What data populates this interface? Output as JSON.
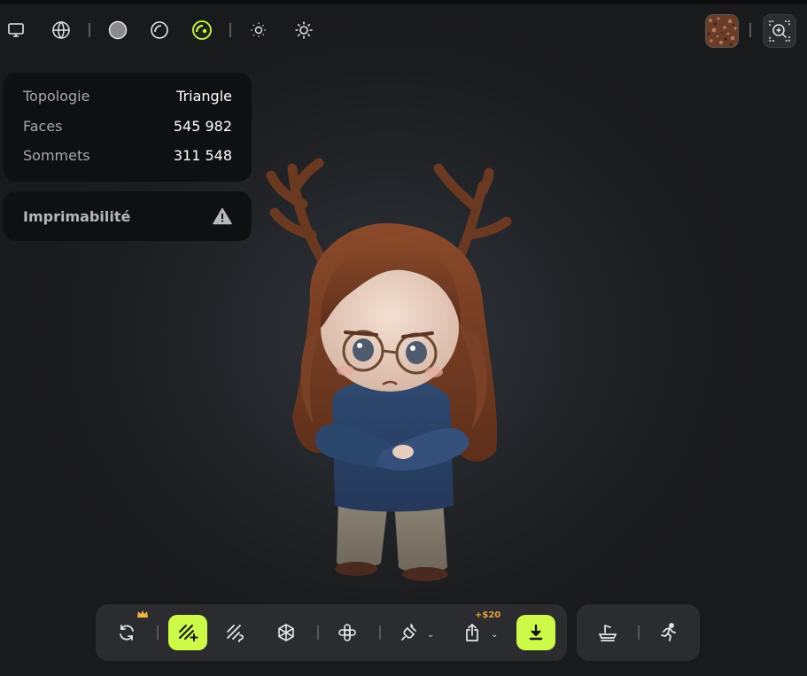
{
  "toolbar": {
    "icons": [
      "monitor-icon",
      "wireframe-globe-icon",
      "solid-sphere-icon",
      "matcap-sphere-icon",
      "textured-sphere-icon",
      "light-dim-icon",
      "light-bright-icon"
    ],
    "active_icon": "textured-sphere-icon",
    "accent": "#cdfa46"
  },
  "info": {
    "rows": [
      {
        "label": "Topologie",
        "value": "Triangle"
      },
      {
        "label": "Faces",
        "value": "545 982"
      },
      {
        "label": "Sommets",
        "value": "311 548"
      }
    ]
  },
  "printability": {
    "label": "Imprimabilité",
    "icon": "warning-icon"
  },
  "bottom_toolbar": {
    "price": "+$20",
    "buttons": [
      "regenerate-icon",
      "texture-add-icon",
      "texture-edit-icon",
      "mesh-icon",
      "move-icon",
      "plugin-icon",
      "export-icon",
      "download-icon"
    ],
    "side_buttons": [
      "pose-platform-icon",
      "animate-run-icon"
    ]
  },
  "colors": {
    "accent": "#cdfa46",
    "panel": "#0f1011",
    "toolbar": "#2a2c2f",
    "price": "#e8a13a"
  }
}
